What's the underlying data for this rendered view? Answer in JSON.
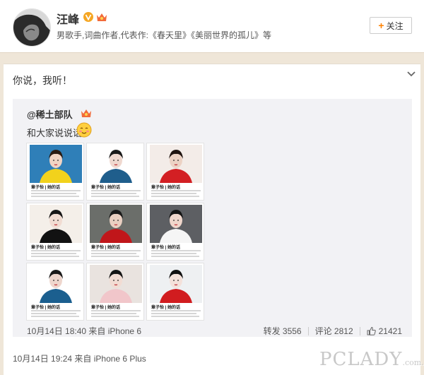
{
  "profile": {
    "name": "汪峰",
    "bio": "男歌手,词曲作者,代表作:《春天里》《美丽世界的孤儿》等",
    "follow_label": "关注"
  },
  "post": {
    "text": "你说，我听！",
    "time_source": "10月14日 19:24 来自 iPhone 6 Plus"
  },
  "repost": {
    "user": "@稀土部队",
    "text": "和大家说说话",
    "time_source": "10月14日 18:40 来自 iPhone 6",
    "forward_label": "转发 3556",
    "comment_label": "评论 2812",
    "like_count": "21421",
    "images": [
      {
        "caption": "章子怡 | 她的话",
        "scene": "yellow-dress"
      },
      {
        "caption": "章子怡 | 她的话",
        "scene": "floral-top"
      },
      {
        "caption": "章子怡 | 她的话",
        "scene": "red-gown"
      },
      {
        "caption": "章子怡 | 她的话",
        "scene": "black-white-wrap"
      },
      {
        "caption": "章子怡 | 她的话",
        "scene": "red-ruffle"
      },
      {
        "caption": "章子怡 | 她的话",
        "scene": "white-collar"
      },
      {
        "caption": "章子怡 | 她的话",
        "scene": "blue-floral"
      },
      {
        "caption": "章子怡 | 她的话",
        "scene": "pink-coat"
      },
      {
        "caption": "章子怡 | 她的话",
        "scene": "red-fur"
      }
    ]
  },
  "watermark": {
    "text": "PCLADY",
    "domain": ".com.cn"
  },
  "colors": {
    "accent_orange": "#ff8200",
    "verified_gold": "#f5a623",
    "background": "#efe6d8",
    "repost_bg": "#f2f2f5"
  }
}
